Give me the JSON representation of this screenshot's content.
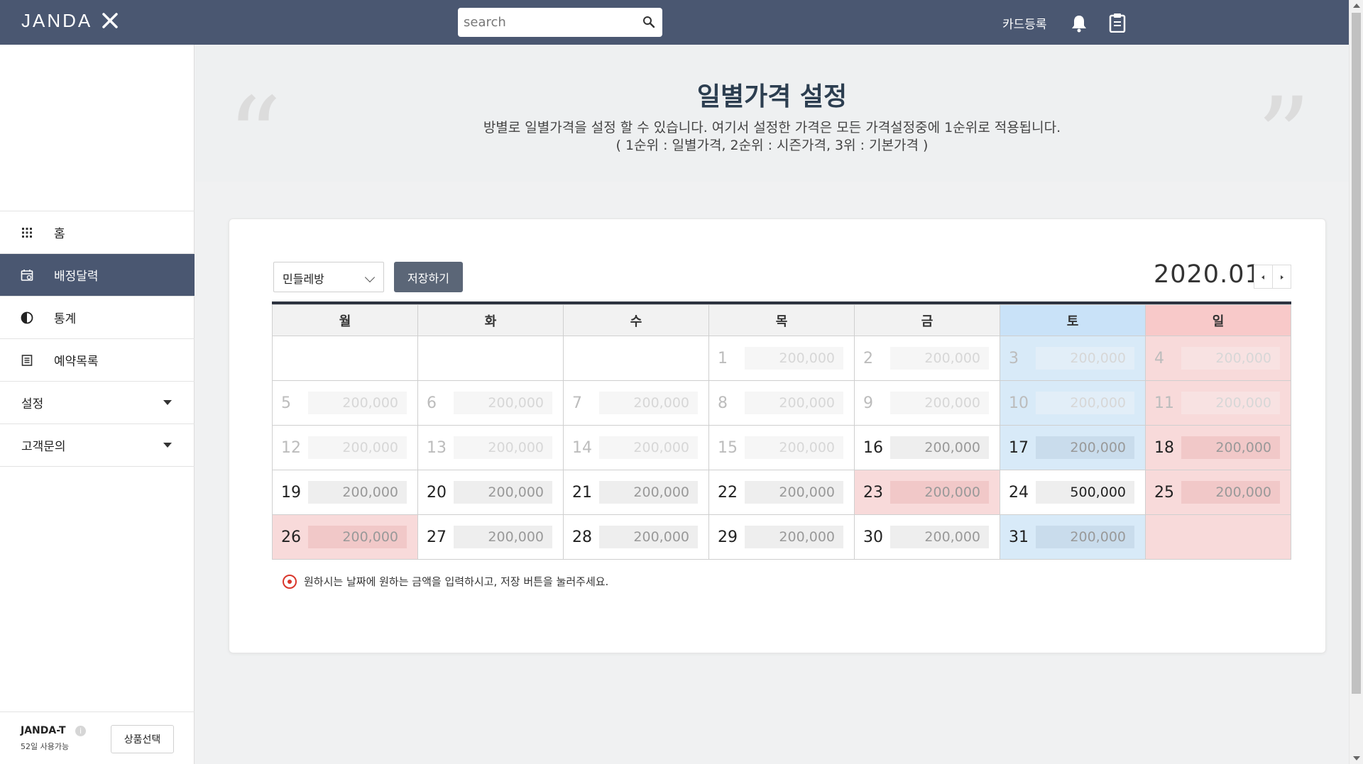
{
  "header": {
    "logo_text": "JANDA",
    "search_placeholder": "search",
    "card_register": "카드등록"
  },
  "sidebar": {
    "items": [
      {
        "label": "홈"
      },
      {
        "label": "배정달력"
      },
      {
        "label": "통계"
      },
      {
        "label": "예약목록"
      },
      {
        "label": "설정"
      },
      {
        "label": "고객문의"
      }
    ],
    "account": "JANDA-T",
    "account_days": "52일 사용가능",
    "product_button": "상품선택"
  },
  "banner": {
    "title": "일별가격 설정",
    "desc1": "방별로 일별가격을 설정 할 수 있습니다. 여기서 설정한 가격은 모든 가격설정중에 1순위로 적용됩니다.",
    "desc2": "( 1순위 : 일별가격, 2순위 : 시즌가격, 3위 : 기본가격 )"
  },
  "toolbar": {
    "room_selected": "민들레방",
    "save_label": "저장하기",
    "month": "2020.01"
  },
  "calendar": {
    "weekdays": [
      "월",
      "화",
      "수",
      "목",
      "금",
      "토",
      "일"
    ],
    "weeks": [
      [
        {
          "day": "",
          "price": "",
          "type": "empty"
        },
        {
          "day": "",
          "price": "",
          "type": "empty"
        },
        {
          "day": "",
          "price": "",
          "type": "empty"
        },
        {
          "day": "1",
          "price": "200,000",
          "type": "past"
        },
        {
          "day": "2",
          "price": "200,000",
          "type": "past"
        },
        {
          "day": "3",
          "price": "200,000",
          "type": "past sat"
        },
        {
          "day": "4",
          "price": "200,000",
          "type": "past sun"
        }
      ],
      [
        {
          "day": "5",
          "price": "200,000",
          "type": "past"
        },
        {
          "day": "6",
          "price": "200,000",
          "type": "past"
        },
        {
          "day": "7",
          "price": "200,000",
          "type": "past"
        },
        {
          "day": "8",
          "price": "200,000",
          "type": "past"
        },
        {
          "day": "9",
          "price": "200,000",
          "type": "past"
        },
        {
          "day": "10",
          "price": "200,000",
          "type": "past sat"
        },
        {
          "day": "11",
          "price": "200,000",
          "type": "past sun"
        }
      ],
      [
        {
          "day": "12",
          "price": "200,000",
          "type": "past"
        },
        {
          "day": "13",
          "price": "200,000",
          "type": "past"
        },
        {
          "day": "14",
          "price": "200,000",
          "type": "past"
        },
        {
          "day": "15",
          "price": "200,000",
          "type": "past"
        },
        {
          "day": "16",
          "price": "200,000",
          "type": ""
        },
        {
          "day": "17",
          "price": "200,000",
          "type": "sat"
        },
        {
          "day": "18",
          "price": "200,000",
          "type": "sun"
        }
      ],
      [
        {
          "day": "19",
          "price": "200,000",
          "type": ""
        },
        {
          "day": "20",
          "price": "200,000",
          "type": ""
        },
        {
          "day": "21",
          "price": "200,000",
          "type": ""
        },
        {
          "day": "22",
          "price": "200,000",
          "type": ""
        },
        {
          "day": "23",
          "price": "200,000",
          "type": "hol"
        },
        {
          "day": "24",
          "price": "500,000",
          "type": "hl"
        },
        {
          "day": "25",
          "price": "200,000",
          "type": "hol"
        }
      ],
      [
        {
          "day": "26",
          "price": "200,000",
          "type": "hol"
        },
        {
          "day": "27",
          "price": "200,000",
          "type": ""
        },
        {
          "day": "28",
          "price": "200,000",
          "type": ""
        },
        {
          "day": "29",
          "price": "200,000",
          "type": ""
        },
        {
          "day": "30",
          "price": "200,000",
          "type": ""
        },
        {
          "day": "31",
          "price": "200,000",
          "type": "sat"
        },
        {
          "day": "",
          "price": "",
          "type": "sun empty"
        }
      ]
    ]
  },
  "hint": "원하시는 날짜에 원하는 금액을 입력하시고, 저장 버튼을 눌러주세요."
}
